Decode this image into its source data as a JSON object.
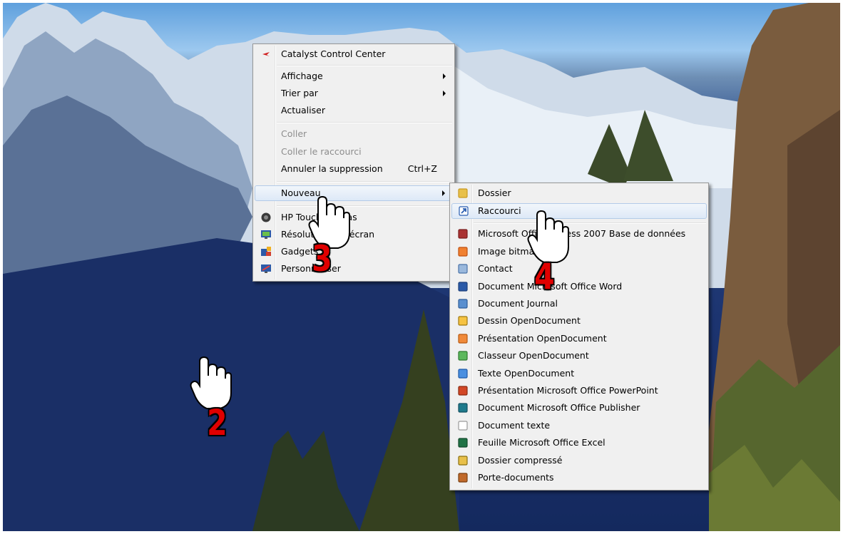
{
  "context_menu": {
    "items": [
      {
        "label": "Catalyst Control Center",
        "icon": "catalyst-icon"
      },
      {
        "label": "Affichage",
        "submenu": true
      },
      {
        "label": "Trier par",
        "submenu": true
      },
      {
        "label": "Actualiser"
      },
      {
        "label": "Coller",
        "disabled": true
      },
      {
        "label": "Coller le raccourci",
        "disabled": true
      },
      {
        "label": "Annuler la suppression",
        "shortcut": "Ctrl+Z"
      },
      {
        "label": "Nouveau",
        "submenu": true,
        "highlighted": true
      },
      {
        "label": "HP Touch Canvas",
        "icon": "hp-icon"
      },
      {
        "label": "Résolution de l'écran",
        "icon": "screen-resolution-icon"
      },
      {
        "label": "Gadgets",
        "icon": "gadgets-icon"
      },
      {
        "label": "Personnaliser",
        "icon": "personalize-icon"
      }
    ]
  },
  "submenu_nouveau": {
    "items": [
      {
        "label": "Dossier",
        "icon": "folder-icon"
      },
      {
        "label": "Raccourci",
        "icon": "shortcut-icon",
        "highlighted": true
      },
      {
        "label": "Microsoft Office Access 2007 Base de données",
        "icon": "access-icon"
      },
      {
        "label": "Image bitmap",
        "icon": "bitmap-icon"
      },
      {
        "label": "Contact",
        "icon": "contact-icon"
      },
      {
        "label": "Document Microsoft Office Word",
        "icon": "word-icon"
      },
      {
        "label": "Document Journal",
        "icon": "journal-icon"
      },
      {
        "label": "Dessin OpenDocument",
        "icon": "od-drawing-icon"
      },
      {
        "label": "Présentation OpenDocument",
        "icon": "od-presentation-icon"
      },
      {
        "label": "Classeur OpenDocument",
        "icon": "od-spreadsheet-icon"
      },
      {
        "label": "Texte OpenDocument",
        "icon": "od-text-icon"
      },
      {
        "label": "Présentation Microsoft Office PowerPoint",
        "icon": "powerpoint-icon"
      },
      {
        "label": "Document Microsoft Office Publisher",
        "icon": "publisher-icon"
      },
      {
        "label": "Document texte",
        "icon": "text-document-icon"
      },
      {
        "label": "Feuille Microsoft Office Excel",
        "icon": "excel-icon"
      },
      {
        "label": "Dossier compressé",
        "icon": "zip-folder-icon"
      },
      {
        "label": "Porte-documents",
        "icon": "briefcase-icon"
      }
    ]
  },
  "step_labels": {
    "step2": "2",
    "step3": "3",
    "step4": "4"
  },
  "colors": {
    "step_number": "#e00000",
    "menu_bg": "#f0f0f0",
    "highlight_border": "#b3cbe8"
  }
}
